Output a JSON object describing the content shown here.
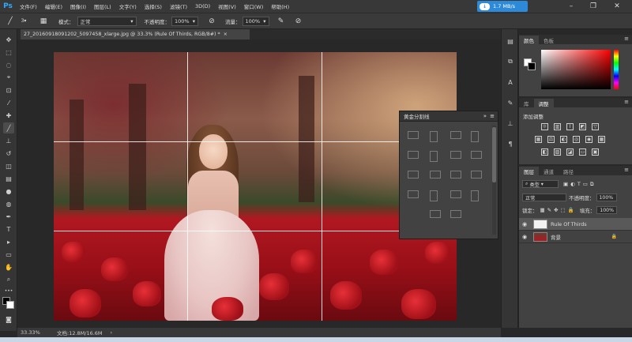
{
  "menubar": {
    "logo": "Ps",
    "items": [
      "文件(F)",
      "编辑(E)",
      "图像(I)",
      "图层(L)",
      "文字(Y)",
      "选择(S)",
      "滤镜(T)",
      "3D(D)",
      "视图(V)",
      "窗口(W)",
      "帮助(H)"
    ],
    "network_speed": "1.7 MB/s",
    "window_controls": [
      "minimize-icon",
      "restore-icon",
      "close-icon"
    ]
  },
  "options": {
    "brush_size": "3",
    "mode_label": "模式：",
    "mode_value": "正常",
    "opacity_label": "不透明度：",
    "opacity_value": "100%",
    "flow_label": "流量：",
    "flow_value": "100%"
  },
  "document": {
    "tab_title": "27_20160918091202_5097458_xlarge.jpg @ 33.3% (Rule Of Thirds, RGB/8#) *",
    "close": "×"
  },
  "status": {
    "zoom": "33.33%",
    "doc_info": "文档:12.8M/16.6M",
    "arrow": "›"
  },
  "float_panel": {
    "title": "黄金分割线",
    "double_arrow": "»",
    "menu_icon": "≡"
  },
  "color_panel": {
    "tabs": [
      "颜色",
      "色板"
    ],
    "menu_icon": "≡"
  },
  "adjust_panel": {
    "tabs": [
      "库",
      "调整"
    ],
    "title": "添加调整",
    "menu_icon": "≡"
  },
  "layers_panel": {
    "tabs": [
      "图层",
      "通道",
      "路径"
    ],
    "menu_icon": "≡",
    "filter_label": "类型",
    "blend_mode": "正常",
    "opacity_label": "不透明度：",
    "opacity_value": "100%",
    "lock_label": "锁定：",
    "fill_label": "填充：",
    "fill_value": "100%",
    "layers": [
      {
        "name": "Rule Of Thirds",
        "selected": true
      },
      {
        "name": "背景",
        "selected": false
      }
    ]
  },
  "colors": {
    "accent": "#2c8ad8",
    "background": "#282828",
    "panel": "#424242"
  }
}
